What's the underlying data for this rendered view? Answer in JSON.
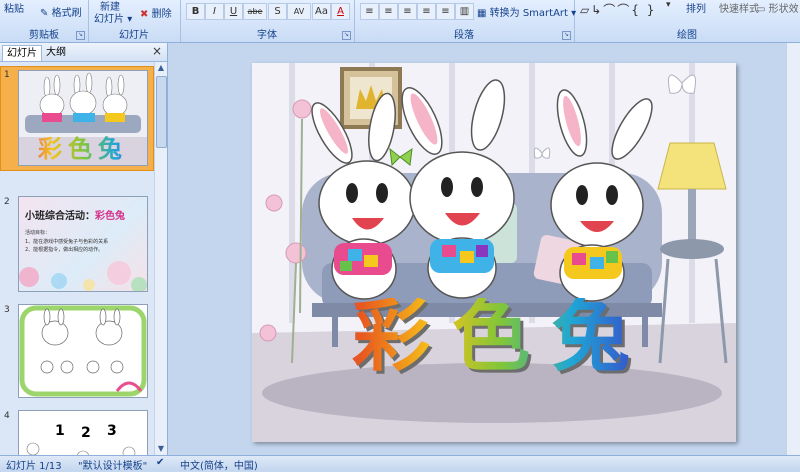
{
  "ribbon": {
    "clipboard": {
      "paste": "粘贴",
      "format_painter": "格式刷",
      "label": "剪贴板"
    },
    "slides": {
      "new_slide_line1": "新建",
      "new_slide_line2": "幻灯片",
      "delete": "删除",
      "label": "幻灯片"
    },
    "font": {
      "label": "字体",
      "buttons": [
        "B",
        "I",
        "U",
        "abe",
        "S",
        "AV",
        "Aa",
        "A"
      ]
    },
    "paragraph": {
      "label": "段落",
      "smartart": "转换为 SmartArt"
    },
    "drawing": {
      "label": "绘图",
      "arrange": "排列",
      "quick_styles": "快速样式",
      "shape_outline": "形状效"
    }
  },
  "pane": {
    "tab_slides": "幻灯片",
    "tab_outline": "大纲",
    "close": "×",
    "thumbnails": [
      {
        "num": "1",
        "title": "彩色兔"
      },
      {
        "num": "2",
        "title": "小班综合活动：",
        "title_color": "彩色兔",
        "line1": "活动目标：",
        "line2": "1、能在游戏中感受兔子与色彩的关系",
        "line3": "2、能根据指令，做出相应的动作。"
      },
      {
        "num": "3"
      },
      {
        "num": "4",
        "digits": [
          "1",
          "2",
          "3"
        ]
      }
    ]
  },
  "slide": {
    "title": "彩色兔"
  },
  "status": {
    "slide_count": "幻灯片 1/13",
    "theme": "\"默认设计模板\"",
    "language": "中文(简体，中国)"
  },
  "colors": {
    "ribbon": "#c9dcf5",
    "accent": "#15428b",
    "selected_thumb": "#f6b04b"
  }
}
